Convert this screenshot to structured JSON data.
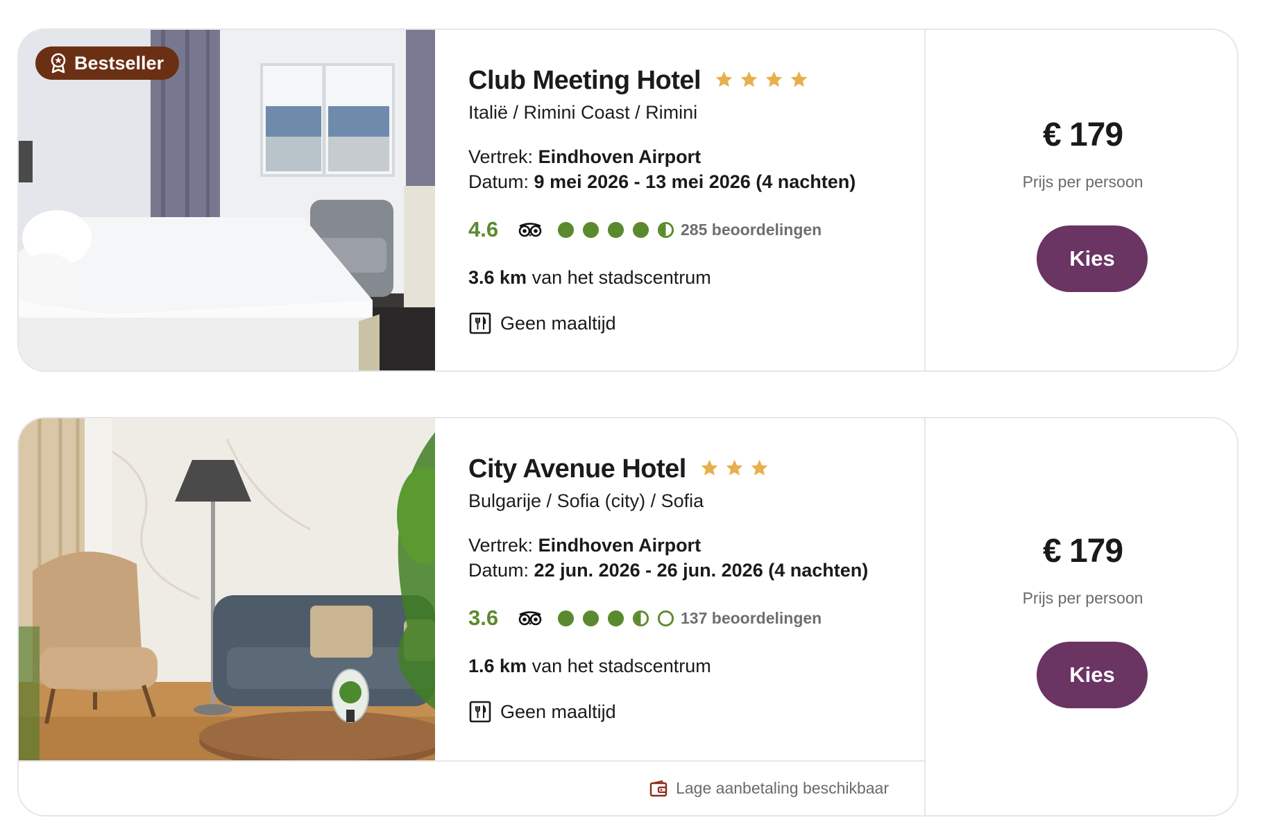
{
  "hotels": [
    {
      "badge": "Bestseller",
      "name": "Club Meeting Hotel",
      "stars": 4,
      "location": "Italië / Rimini Coast / Rimini",
      "departure_label": "Vertrek:",
      "departure_value": "Eindhoven Airport",
      "date_label": "Datum:",
      "date_value": "9 mei 2026 - 13 mei 2026 (4 nachten)",
      "rating": "4.6",
      "rating_bubbles": 4.5,
      "reviews": "285 beoordelingen",
      "distance_value": "3.6 km",
      "distance_text": "van het stadscentrum",
      "meal": "Geen maaltijd",
      "price": "€ 179",
      "price_label": "Prijs per persoon",
      "cta": "Kies"
    },
    {
      "name": "City Avenue Hotel",
      "stars": 3,
      "location": "Bulgarije / Sofia (city) / Sofia",
      "departure_label": "Vertrek:",
      "departure_value": "Eindhoven Airport",
      "date_label": "Datum:",
      "date_value": "22 jun. 2026 - 26 jun. 2026 (4 nachten)",
      "rating": "3.6",
      "rating_bubbles": 3.5,
      "reviews": "137 beoordelingen",
      "distance_value": "1.6 km",
      "distance_text": "van het stadscentrum",
      "meal": "Geen maaltijd",
      "price": "€ 179",
      "price_label": "Prijs per persoon",
      "cta": "Kies",
      "footer_note": "Lage aanbetaling beschikbaar"
    }
  ],
  "icons": {
    "badge": "award-ribbon-icon",
    "star": "star-icon",
    "tripadvisor": "tripadvisor-owl-icon",
    "meal": "cutlery-icon",
    "payment": "wallet-icon"
  },
  "colors": {
    "star": "#e8b04d",
    "rating": "#5b8a2e",
    "button": "#6a3463",
    "badge": "#6b2f14",
    "wallet_icon": "#8b2c1a"
  }
}
